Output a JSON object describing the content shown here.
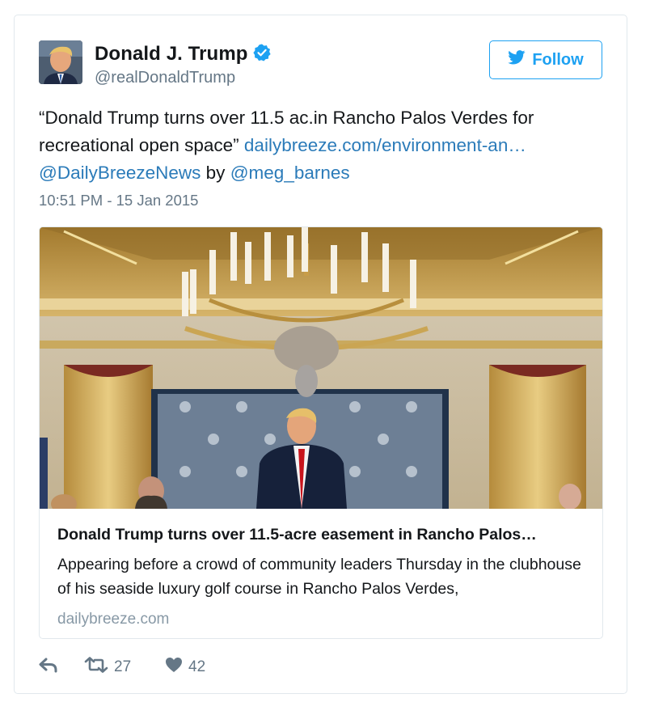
{
  "user": {
    "name": "Donald J. Trump",
    "handle": "@realDonaldTrump",
    "verified": true
  },
  "follow_button": {
    "label": "Follow"
  },
  "tweet": {
    "quote_text": "“Donald Trump turns over 11.5 ac.in Rancho Palos Verdes for recreational open space”",
    "link_text": "dailybreeze.com/environment-an…",
    "mention_1": "@DailyBreezeNews",
    "by_text": "by",
    "mention_2": "@meg_barnes",
    "timestamp": "10:51 PM - 15 Jan 2015"
  },
  "card": {
    "title": "Donald Trump turns over 11.5-acre easement in Rancho Palos…",
    "description": "Appearing before a crowd of community leaders Thursday in the clubhouse of his seaside luxury golf course in Rancho Palos Verdes,",
    "domain": "dailybreeze.com"
  },
  "actions": {
    "retweet_count": "27",
    "like_count": "42"
  },
  "colors": {
    "accent": "#1da1f2",
    "link": "#2b7bb9",
    "muted": "#657786",
    "border": "#e1e8ed"
  }
}
